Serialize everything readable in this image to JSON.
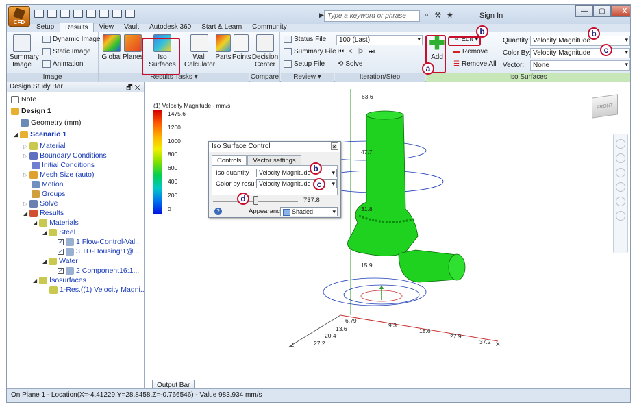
{
  "app": {
    "logo_label": "CFD"
  },
  "search": {
    "placeholder": "Type a keyword or phrase"
  },
  "signin": "Sign In",
  "window": {
    "minimize": "—",
    "maximize": "▢",
    "close": "X"
  },
  "tabs": [
    "Setup",
    "Results",
    "View",
    "Vault",
    "Autodesk 360",
    "Start & Learn",
    "Community"
  ],
  "ribbon": {
    "image_group": {
      "label": "Image",
      "summary": "Summary\nImage",
      "dynamic": "Dynamic Image",
      "static": "Static Image",
      "animation": "Animation"
    },
    "results_tasks": {
      "label": "Results Tasks ▾",
      "global": "Global",
      "planes": "Planes",
      "iso": "Iso Surfaces",
      "wall": "Wall\nCalculator",
      "parts": "Parts",
      "points": "Points"
    },
    "compare": {
      "label": "Compare",
      "decision": "Decision\nCenter"
    },
    "review": {
      "label": "Review ▾",
      "status": "Status File",
      "summary": "Summary File",
      "setup": "Setup File"
    },
    "iteration": {
      "label": "Iteration/Step",
      "combo": "100 (Last)",
      "solve": "Solve"
    },
    "iso": {
      "label": "Iso Surfaces",
      "add": "Add",
      "edit": "Edit ▾",
      "remove": "Remove",
      "remove_all": "Remove All",
      "quantity_label": "Quantity:",
      "quantity": "Velocity Magnitude",
      "colorby_label": "Color By:",
      "colorby": "Velocity Magnitude",
      "vector_label": "Vector:",
      "vector": "None"
    }
  },
  "callouts": {
    "a": "a",
    "b": "b",
    "c": "c",
    "d": "d"
  },
  "design_study": {
    "title": "Design Study Bar",
    "pin": "🗗 ✕",
    "items": [
      {
        "label": "Note"
      },
      {
        "label": "Design 1"
      },
      {
        "label": "Geometry (mm)"
      },
      {
        "label": "Scenario 1"
      },
      {
        "label": "Material"
      },
      {
        "label": "Boundary Conditions"
      },
      {
        "label": "Initial Conditions"
      },
      {
        "label": "Mesh Size (auto)"
      },
      {
        "label": "Motion"
      },
      {
        "label": "Groups"
      },
      {
        "label": "Solve"
      },
      {
        "label": "Results"
      },
      {
        "label": "Materials"
      },
      {
        "label": "Steel"
      },
      {
        "label": "1 Flow-Control-Val..."
      },
      {
        "label": "3 TD-Housing:1@..."
      },
      {
        "label": "Water"
      },
      {
        "label": "2 Component16:1..."
      },
      {
        "label": "Isosurfaces"
      },
      {
        "label": "1-Res.((1) Velocity Magni..."
      }
    ]
  },
  "legend": {
    "title": "(1) Velocity Magnitude - mm/s",
    "ticks": [
      "1475.6",
      "1200",
      "1000",
      "800",
      "600",
      "400",
      "200",
      "0"
    ]
  },
  "dialog": {
    "title": "Iso Surface Control",
    "tab_controls": "Controls",
    "tab_vectors": "Vector settings",
    "iso_quantity_label": "Iso quantity",
    "iso_quantity": "Velocity Magnitude",
    "color_by_label": "Color by result",
    "color_by": "Velocity Magnitude",
    "slider_value": "737.8",
    "slider_fraction": 0.5,
    "appearance_label": "Appearance:",
    "appearance": "Shaded",
    "help": "?",
    "close": "⊠"
  },
  "viewport_labels": {
    "top": "63.6",
    "mid1": "47.7",
    "mid2": "31.8",
    "low": "15.9",
    "ax0": "6.79",
    "ax1": "13.6",
    "ax2": "20.4",
    "ax3": "27.2",
    "x1": "9.3",
    "x2": "18.6",
    "x3": "27.9",
    "x4": "37.2",
    "xaxis": "X",
    "zaxis": "Z",
    "viewcube": "FRONT"
  },
  "output_bar": "Output Bar",
  "status": "On Plane 1 - Location(X=-4.41229,Y=28.8458,Z=-0.766546) - Value  983.934  mm/s",
  "colors": {
    "iso_green": "#1fd21f",
    "accent_red": "#c8102e"
  }
}
